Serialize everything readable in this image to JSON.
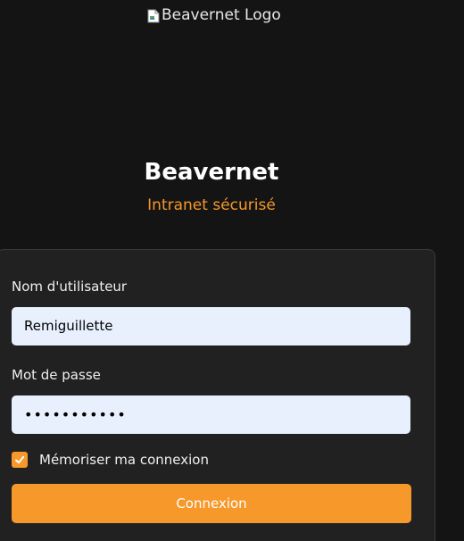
{
  "logo": {
    "alt_text": "Beavernet Logo",
    "icon": "broken-image-icon"
  },
  "brand": {
    "title": "Beavernet",
    "subtitle": "Intranet sécurisé"
  },
  "form": {
    "username_label": "Nom d'utilisateur",
    "username_value": "Remiguillette",
    "password_label": "Mot de passe",
    "password_masked": "•••••••••••",
    "remember_label": "Mémoriser ma connexion",
    "remember_checked": true,
    "submit_label": "Connexion"
  },
  "colors": {
    "background": "#141414",
    "card": "#212121",
    "accent": "#f7982a",
    "input_bg": "#e8f0fe"
  }
}
